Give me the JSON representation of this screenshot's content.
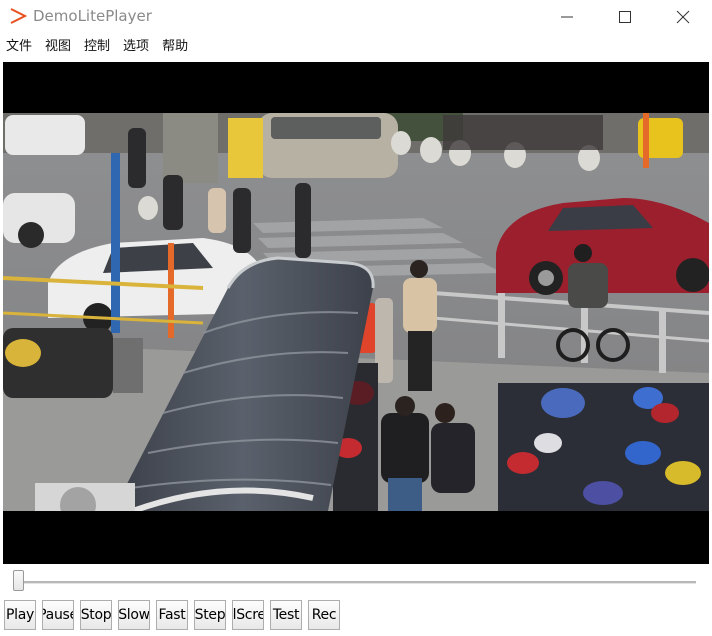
{
  "window": {
    "title": "DemoLitePlayer",
    "minimize_icon": "minimize-icon",
    "maximize_icon": "maximize-icon",
    "close_icon": "close-icon",
    "app_icon": "play-triangle-icon",
    "accent": "#e8501e"
  },
  "menu": {
    "items": [
      "文件",
      "视图",
      "控制",
      "选项",
      "帮助"
    ]
  },
  "player": {
    "position_fraction": 0
  },
  "controls": {
    "buttons": [
      "Play",
      "Pause",
      "Stop",
      "Slow",
      "Fast",
      "Step",
      "FullScreen",
      "Test",
      "Rec"
    ]
  }
}
